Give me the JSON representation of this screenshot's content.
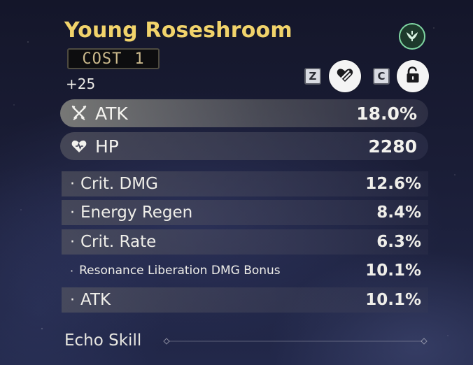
{
  "echo": {
    "name": "Young Roseshroom",
    "cost_label": "COST",
    "cost_value": "1",
    "level": "+25"
  },
  "controls": {
    "sonata_icon": "sonata-wing-icon",
    "discard_key": "Z",
    "discard_icon": "heart-slash-icon",
    "lock_key": "C",
    "lock_icon": "unlock-icon"
  },
  "main_stats": [
    {
      "icon": "atk-crossed-swords-icon",
      "label": "ATK",
      "value": "18.0%"
    },
    {
      "icon": "hp-heart-icon",
      "label": "HP",
      "value": "2280"
    }
  ],
  "sub_stats": [
    {
      "label": "Crit. DMG",
      "value": "12.6%"
    },
    {
      "label": "Energy Regen",
      "value": "8.4%"
    },
    {
      "label": "Crit. Rate",
      "value": "6.3%"
    },
    {
      "label": "Resonance Liberation DMG Bonus",
      "value": "10.1%"
    },
    {
      "label": "ATK",
      "value": "10.1%"
    }
  ],
  "footer": {
    "section_label": "Echo Skill"
  },
  "colors": {
    "title": "#f1d36b",
    "sonata_ring": "#7fd6a2",
    "text": "#ecebe6"
  }
}
